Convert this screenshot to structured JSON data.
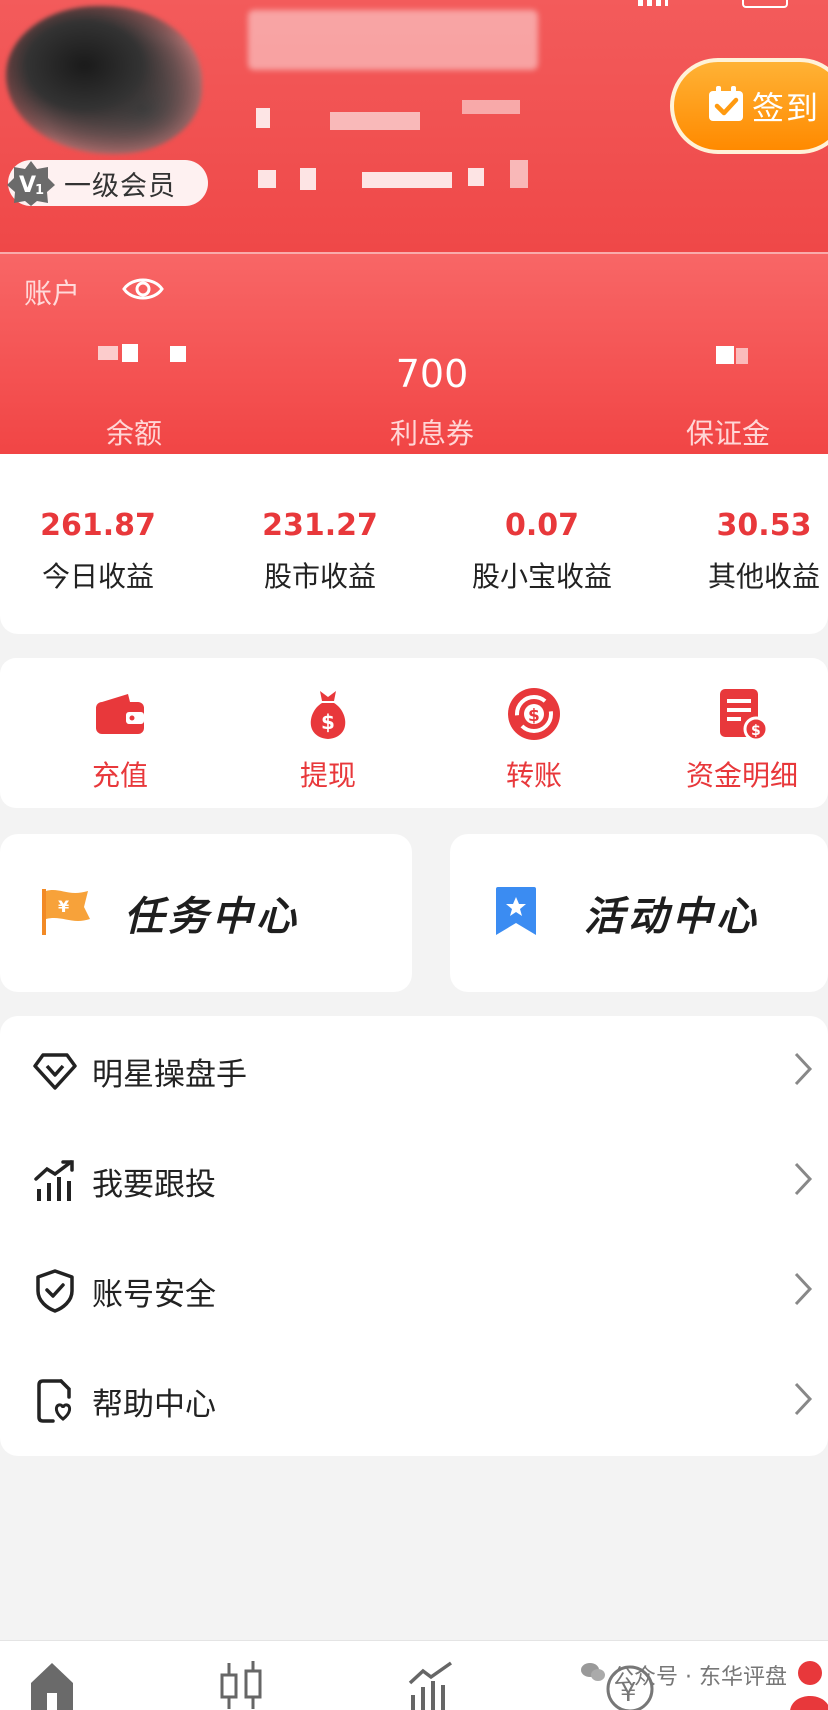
{
  "header": {
    "member_level": "一级会员",
    "checkin_label": "签到"
  },
  "account": {
    "title": "账户",
    "balance_label": "余额",
    "coupon_value": "700",
    "coupon_label": "利息券",
    "margin_label": "保证金"
  },
  "earnings": [
    {
      "value": "261.87",
      "label": "今日收益"
    },
    {
      "value": "231.27",
      "label": "股市收益"
    },
    {
      "value": "0.07",
      "label": "股小宝收益"
    },
    {
      "value": "30.53",
      "label": "其他收益"
    }
  ],
  "actions": [
    {
      "label": "充值",
      "icon": "wallet-icon"
    },
    {
      "label": "提现",
      "icon": "money-bag-icon"
    },
    {
      "label": "转账",
      "icon": "transfer-icon"
    },
    {
      "label": "资金明细",
      "icon": "statement-icon"
    }
  ],
  "cards": {
    "task_center": "任务中心",
    "activity_center": "活动中心"
  },
  "menu": [
    {
      "label": "明星操盘手",
      "icon": "diamond-icon"
    },
    {
      "label": "我要跟投",
      "icon": "chart-up-icon"
    },
    {
      "label": "账号安全",
      "icon": "shield-check-icon"
    },
    {
      "label": "帮助中心",
      "icon": "help-doc-icon"
    }
  ],
  "watermark": "公众号 · 东华评盘",
  "colors": {
    "brand_red": "#e8383b",
    "header_red": "#f14545",
    "checkin_orange": "#ff8a00"
  }
}
